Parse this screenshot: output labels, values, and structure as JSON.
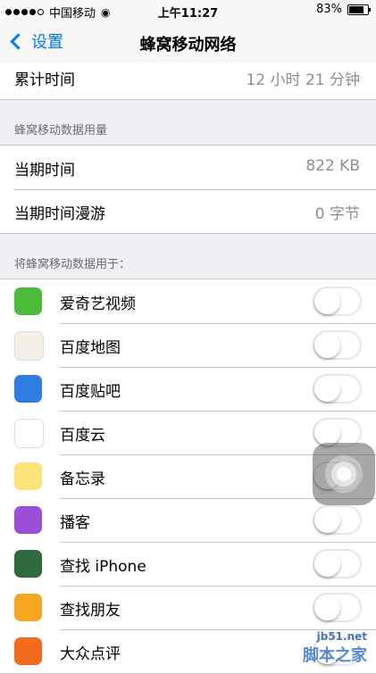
{
  "status_bar": {
    "carrier": "中国移动",
    "time": "上午11:27",
    "battery": "83%"
  },
  "nav": {
    "back_label": "设置",
    "title": "蜂窝移动网络"
  },
  "total_time": {
    "label": "累计时间",
    "value": "12 小时 21 分钟"
  },
  "usage_section": {
    "header": "蜂窝移动数据用量",
    "rows": [
      {
        "label": "当期时间",
        "value": "822 KB"
      },
      {
        "label": "当期时间漫游",
        "value": "0 字节"
      }
    ]
  },
  "apps_section": {
    "header": "将蜂窝移动数据用于：",
    "apps": [
      {
        "name": "爱奇艺视频",
        "icon": "iqiyi-icon",
        "color": "#4cbb3a",
        "on": false
      },
      {
        "name": "百度地图",
        "icon": "baidu-map-icon",
        "color": "#f4f0e6",
        "on": false
      },
      {
        "name": "百度贴吧",
        "icon": "baidu-tieba-icon",
        "color": "#2f7de1",
        "on": false
      },
      {
        "name": "百度云",
        "icon": "baidu-cloud-icon",
        "color": "#ffffff",
        "on": false
      },
      {
        "name": "备忘录",
        "icon": "notes-icon",
        "color": "#fbe47a",
        "on": false
      },
      {
        "name": "播客",
        "icon": "podcasts-icon",
        "color": "#9b4fd8",
        "on": false
      },
      {
        "name": "查找 iPhone",
        "icon": "find-iphone-icon",
        "color": "#2f6b3f",
        "on": false
      },
      {
        "name": "查找朋友",
        "icon": "find-friends-icon",
        "color": "#f5a623",
        "on": false
      },
      {
        "name": "大众点评",
        "icon": "dianping-icon",
        "color": "#f26b1d",
        "on": false
      }
    ]
  },
  "watermark": {
    "text": "脚本之家",
    "sub": "jb51.net"
  }
}
